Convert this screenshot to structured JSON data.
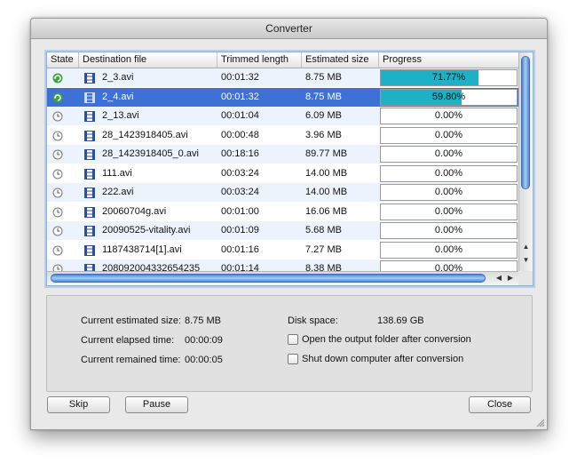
{
  "window": {
    "title": "Converter"
  },
  "table": {
    "columns": [
      "State",
      "Destination file",
      "Trimmed length",
      "Estimated size",
      "Progress"
    ],
    "rows": [
      {
        "state": "converting",
        "file": "2_3.avi",
        "length": "00:01:32",
        "size": "8.75 MB",
        "progress": "71.77%",
        "fraction": 0.7177
      },
      {
        "state": "converting",
        "file": "2_4.avi",
        "length": "00:01:32",
        "size": "8.75 MB",
        "progress": "59.80%",
        "fraction": 0.598,
        "selected": true
      },
      {
        "state": "waiting",
        "file": "2_13.avi",
        "length": "00:01:04",
        "size": "6.09 MB",
        "progress": "0.00%",
        "fraction": 0
      },
      {
        "state": "waiting",
        "file": "28_1423918405.avi",
        "length": "00:00:48",
        "size": "3.96 MB",
        "progress": "0.00%",
        "fraction": 0
      },
      {
        "state": "waiting",
        "file": "28_1423918405_0.avi",
        "length": "00:18:16",
        "size": "89.77 MB",
        "progress": "0.00%",
        "fraction": 0
      },
      {
        "state": "waiting",
        "file": "111.avi",
        "length": "00:03:24",
        "size": "14.00 MB",
        "progress": "0.00%",
        "fraction": 0
      },
      {
        "state": "waiting",
        "file": "222.avi",
        "length": "00:03:24",
        "size": "14.00 MB",
        "progress": "0.00%",
        "fraction": 0
      },
      {
        "state": "waiting",
        "file": "20060704g.avi",
        "length": "00:01:00",
        "size": "16.06 MB",
        "progress": "0.00%",
        "fraction": 0
      },
      {
        "state": "waiting",
        "file": "20090525-vitality.avi",
        "length": "00:01:09",
        "size": "5.68 MB",
        "progress": "0.00%",
        "fraction": 0
      },
      {
        "state": "waiting",
        "file": "1187438714[1].avi",
        "length": "00:01:16",
        "size": "7.27 MB",
        "progress": "0.00%",
        "fraction": 0
      },
      {
        "state": "waiting",
        "file": "20809200433265423​5",
        "length": "00:01:14",
        "size": "8.38 MB",
        "progress": "0.00%",
        "fraction": 0
      }
    ]
  },
  "info": {
    "est_size_label": "Current estimated size:",
    "est_size_value": "8.75 MB",
    "elapsed_label": "Current elapsed time:",
    "elapsed_value": "00:00:09",
    "remained_label": "Current remained time:",
    "remained_value": "00:00:05",
    "disk_label": "Disk space:",
    "disk_value": "138.69 GB",
    "open_folder_label": "Open the output folder after conversion",
    "shutdown_label": "Shut down computer after conversion"
  },
  "buttons": {
    "skip": "Skip",
    "pause": "Pause",
    "close": "Close"
  },
  "colors": {
    "progress_fill": "#1cb1c7",
    "selection": "#3d71d6",
    "converting_icon": "#3aa53a"
  }
}
